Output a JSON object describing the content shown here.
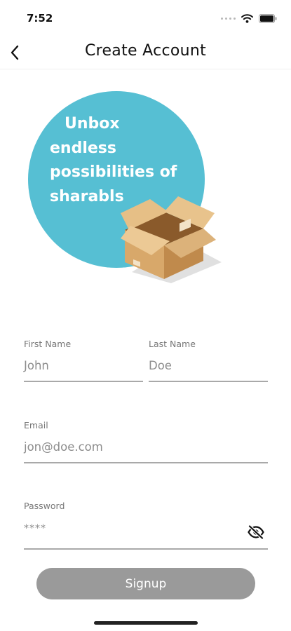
{
  "status_bar": {
    "time": "7:52"
  },
  "header": {
    "title": "Create Account",
    "back_icon": "chevron-left-icon"
  },
  "hero": {
    "lines": [
      "Unbox",
      "endless",
      "possibilities of",
      "sharabls"
    ],
    "circle_color": "#56bfd3",
    "illustration": "open-cardboard-box"
  },
  "form": {
    "first_name": {
      "label": "First Name",
      "value": "John"
    },
    "last_name": {
      "label": "Last Name",
      "value": "Doe"
    },
    "email": {
      "label": "Email",
      "value": "jon@doe.com"
    },
    "password": {
      "label": "Password",
      "value": "****",
      "toggle_icon": "eye-slash-icon"
    }
  },
  "signup": {
    "label": "Signup",
    "color": "#9a9a9a"
  }
}
